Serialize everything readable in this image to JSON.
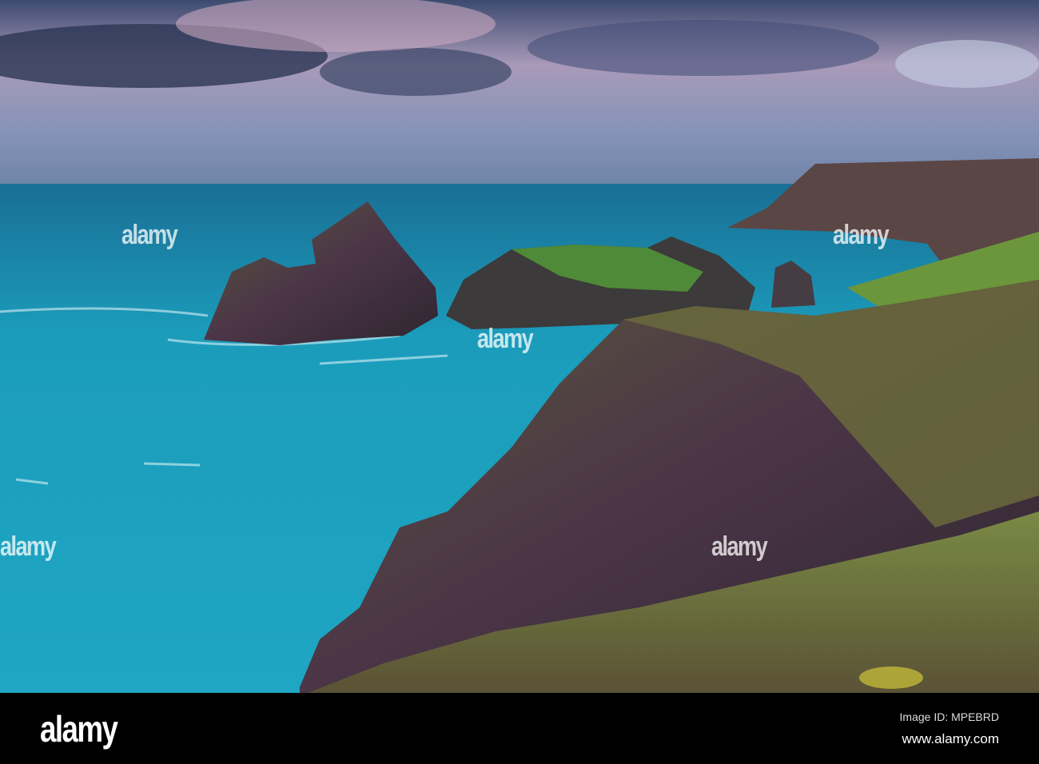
{
  "photo": {
    "subject": "sea stacks and coastal cliffs",
    "colors": {
      "sea": "#1fa3bd",
      "sky": "#5f6f95",
      "cliff": "#4a3a42",
      "grass": "#6f8a3c"
    }
  },
  "watermark": {
    "text": "alamy"
  },
  "footer": {
    "logo": "alamy",
    "image_id": "Image ID: MPEBRD",
    "website": "www.alamy.com"
  }
}
